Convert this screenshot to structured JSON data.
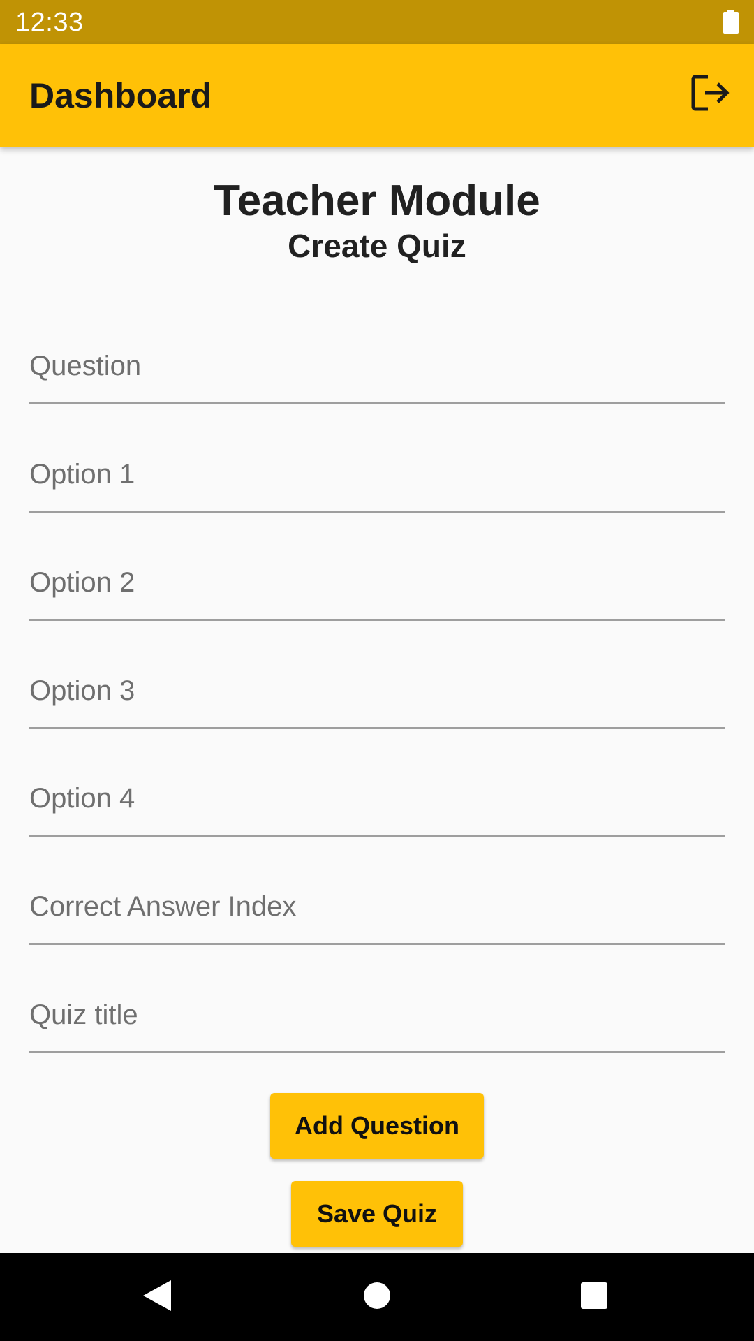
{
  "status_bar": {
    "time": "12:33",
    "battery_icon": "battery-full-icon"
  },
  "app_bar": {
    "title": "Dashboard",
    "action_icon": "logout-icon",
    "background_color": "#ffc107"
  },
  "headings": {
    "main": "Teacher Module",
    "sub": "Create Quiz"
  },
  "form": {
    "fields": [
      {
        "placeholder": "Question",
        "value": ""
      },
      {
        "placeholder": "Option 1",
        "value": ""
      },
      {
        "placeholder": "Option 2",
        "value": ""
      },
      {
        "placeholder": "Option 3",
        "value": ""
      },
      {
        "placeholder": "Option 4",
        "value": ""
      },
      {
        "placeholder": "Correct Answer Index",
        "value": ""
      },
      {
        "placeholder": "Quiz title",
        "value": ""
      }
    ]
  },
  "buttons": {
    "add_question": "Add Question",
    "save_quiz": "Save Quiz",
    "color": "#ffc107"
  },
  "nav_bar": {
    "back_icon": "back-triangle-icon",
    "home_icon": "home-circle-icon",
    "recents_icon": "recents-square-icon"
  }
}
